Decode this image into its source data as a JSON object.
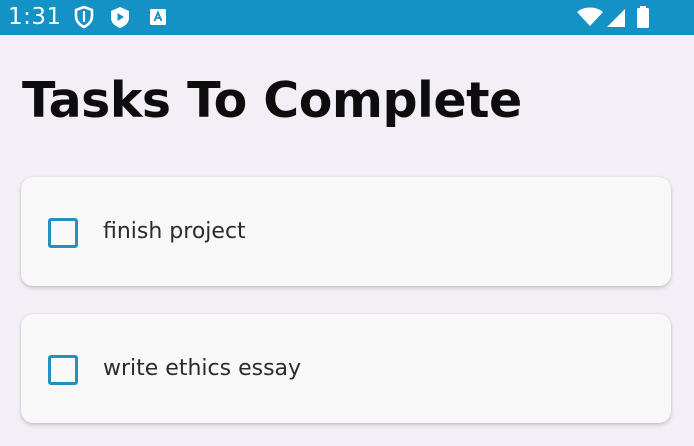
{
  "status_bar": {
    "time": "1:31",
    "background_color": "#1492c6",
    "icons": [
      "shield-icon",
      "play-store-icon",
      "accessibility-text-icon",
      "wifi-icon",
      "cellular-signal-icon",
      "battery-icon"
    ]
  },
  "page": {
    "title": "Tasks To Complete",
    "background_color": "#f4eff6"
  },
  "tasks": [
    {
      "label": "finish project",
      "checked": false
    },
    {
      "label": "write ethics essay",
      "checked": false
    }
  ],
  "colors": {
    "checkbox_border": "#2590bf",
    "card_background": "#f8f8f8"
  }
}
